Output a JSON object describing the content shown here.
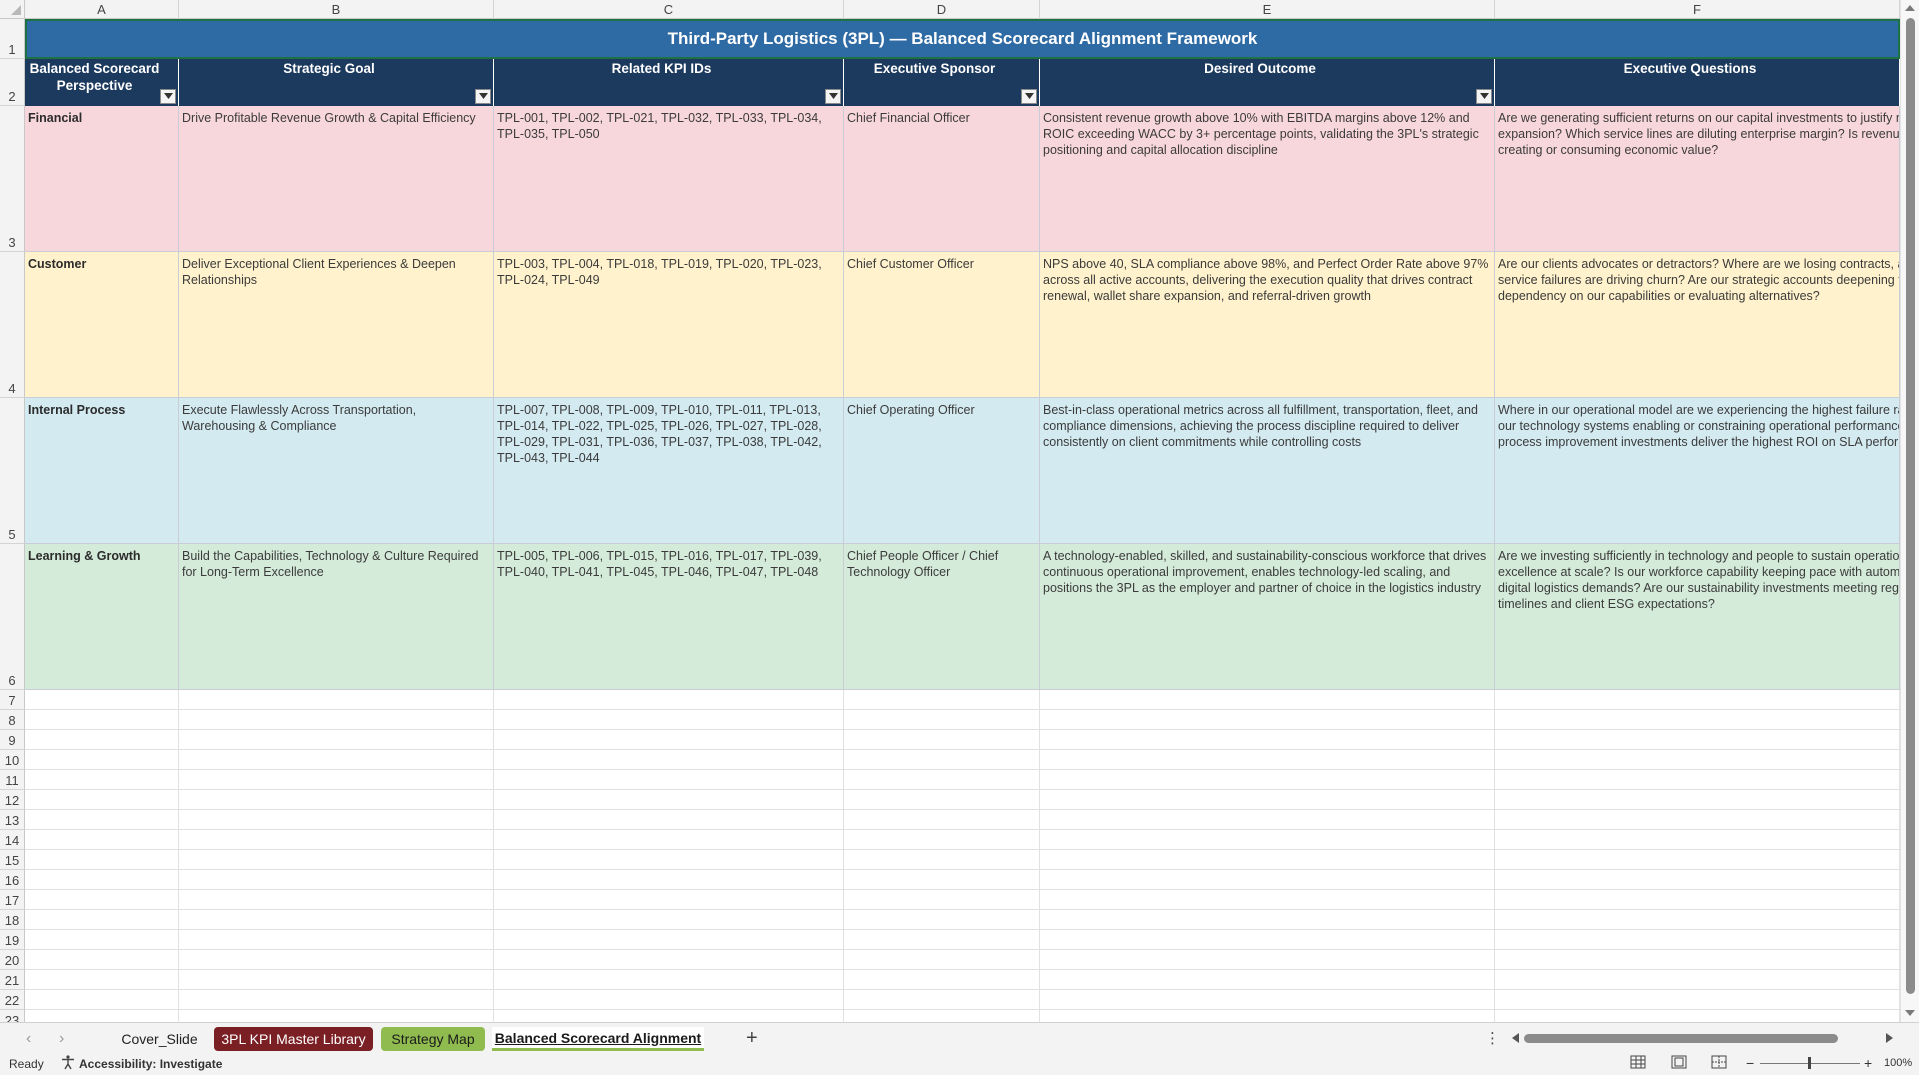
{
  "columns": [
    "A",
    "B",
    "C",
    "D",
    "E",
    "F"
  ],
  "rows": [
    "1",
    "2",
    "3",
    "4",
    "5",
    "6",
    "7",
    "8",
    "9",
    "10",
    "11",
    "12",
    "13",
    "14",
    "15",
    "16",
    "17",
    "18",
    "19",
    "20",
    "21",
    "22",
    "23"
  ],
  "title": "Third-Party Logistics (3PL) — Balanced Scorecard Alignment Framework",
  "headers": [
    "Balanced Scorecard Perspective",
    "Strategic Goal",
    "Related KPI IDs",
    "Executive Sponsor",
    "Desired Outcome",
    "Executive Questions"
  ],
  "records": [
    {
      "perspective": "Financial",
      "goal": "Drive Profitable Revenue Growth & Capital Efficiency",
      "kpis": "TPL-001, TPL-002, TPL-021, TPL-032, TPL-033, TPL-034, TPL-035, TPL-050",
      "sponsor": "Chief Financial Officer",
      "outcome": "Consistent revenue growth above 10% with EBITDA margins above 12% and ROIC exceeding WACC by 3+ percentage points, validating the 3PL's strategic positioning and capital allocation discipline",
      "questions": "Are we generating sufficient returns on our capital investments to justify network expansion? Which service lines are diluting enterprise margin? Is revenue growth creating or consuming economic value?",
      "color": "#f8d7dc"
    },
    {
      "perspective": "Customer",
      "goal": "Deliver Exceptional Client Experiences & Deepen Relationships",
      "kpis": "TPL-003, TPL-004, TPL-018, TPL-019, TPL-020, TPL-023, TPL-024, TPL-049",
      "sponsor": "Chief Customer Officer",
      "outcome": "NPS above 40, SLA compliance above 98%, and Perfect Order Rate above 97% across all active accounts, delivering the execution quality that drives contract renewal, wallet share expansion, and referral-driven growth",
      "questions": "Are our clients advocates or detractors? Where are we losing contracts, and which service failures are driving churn? Are our strategic accounts deepening their dependency on our capabilities or evaluating alternatives?",
      "color": "#fff2cc"
    },
    {
      "perspective": "Internal Process",
      "goal": "Execute Flawlessly Across Transportation, Warehousing & Compliance",
      "kpis": "TPL-007, TPL-008, TPL-009, TPL-010, TPL-011, TPL-013, TPL-014, TPL-022, TPL-025, TPL-026, TPL-027, TPL-028, TPL-029, TPL-031, TPL-036, TPL-037, TPL-038, TPL-042, TPL-043, TPL-044",
      "sponsor": "Chief Operating Officer",
      "outcome": "Best-in-class operational metrics across all fulfillment, transportation, fleet, and compliance dimensions, achieving the process discipline required to deliver consistently on client commitments while controlling costs",
      "questions": "Where in our operational model are we experiencing the highest failure rates? Are our technology systems enabling or constraining operational performance? Which process improvement investments deliver the highest ROI on SLA performance?",
      "color": "#d3eaf0"
    },
    {
      "perspective": "Learning & Growth",
      "goal": "Build the Capabilities, Technology & Culture Required for Long-Term Excellence",
      "kpis": "TPL-005, TPL-006, TPL-015, TPL-016, TPL-017, TPL-039, TPL-040, TPL-041, TPL-045, TPL-046, TPL-047, TPL-048",
      "sponsor": "Chief People Officer / Chief Technology Officer",
      "outcome": "A technology-enabled, skilled, and sustainability-conscious workforce that drives continuous operational improvement, enables technology-led scaling, and positions the 3PL as the employer and partner of choice in the logistics industry",
      "questions": "Are we investing sufficiently in technology and people to sustain operational excellence at scale? Is our workforce capability keeping pace with automation and digital logistics demands? Are our sustainability investments meeting regulatory timelines and client ESG expectations?",
      "color": "#d5ebd9"
    }
  ],
  "tabs": [
    {
      "label": "Cover_Slide",
      "bg": "#f3f3f3",
      "fg": "#222222"
    },
    {
      "label": "3PL KPI Master Library",
      "bg": "#7a1f24",
      "fg": "#ffffff"
    },
    {
      "label": "Strategy Map",
      "bg": "#8fbb4f",
      "fg": "#1a1a1a"
    },
    {
      "label": "Balanced Scorecard Alignment",
      "bg": "#ffffff",
      "fg": "#1a1a1a"
    }
  ],
  "status": {
    "ready": "Ready",
    "accessibility": "Accessibility: Investigate",
    "zoom": "100%"
  }
}
